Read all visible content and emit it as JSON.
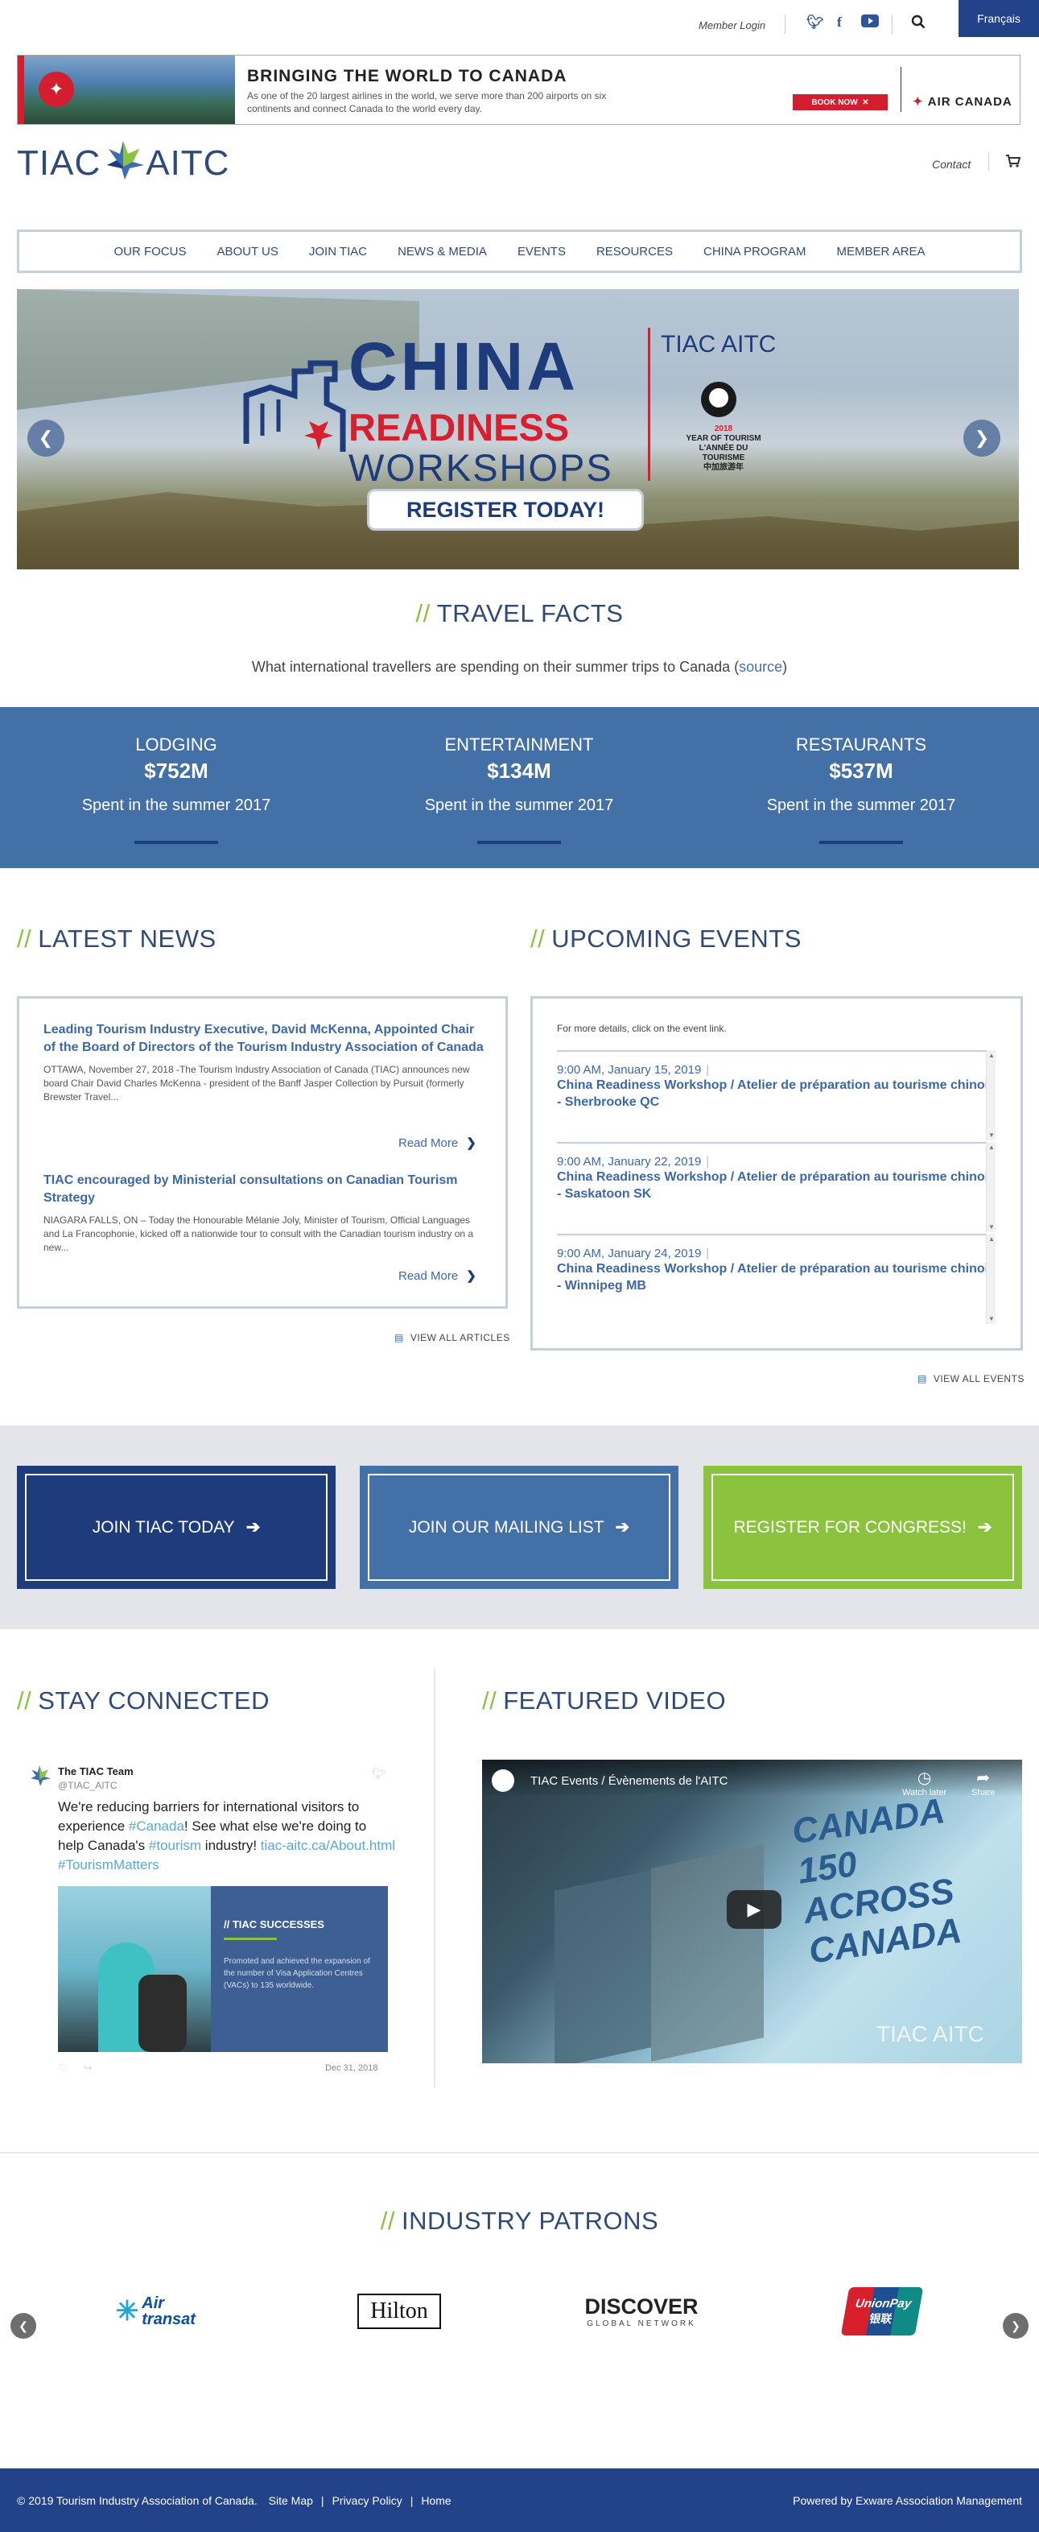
{
  "topbar": {
    "member_login": "Member Login",
    "language": "Français"
  },
  "ad": {
    "headline": "BRINGING THE WORLD TO CANADA",
    "subtext": "As one of the 20 largest airlines in the world, we serve more than 200 airports on six continents and connect Canada to the world every day.",
    "cta": "BOOK NOW",
    "brand": "AIR CANADA"
  },
  "logo": {
    "left": "TIAC",
    "right": "AITC"
  },
  "header": {
    "contact": "Contact"
  },
  "nav": [
    "OUR FOCUS",
    "ABOUT US",
    "JOIN TIAC",
    "NEWS & MEDIA",
    "EVENTS",
    "RESOURCES",
    "CHINA PROGRAM",
    "MEMBER AREA"
  ],
  "hero": {
    "line1": "CHINA",
    "line2": "READINESS",
    "line3": "WORKSHOPS",
    "logo": "TIAC AITC",
    "year_line1": "2018",
    "year_line2": "YEAR OF TOURISM",
    "year_line3": "L'ANNÉE DU TOURISME",
    "year_line4": "中加旅游年",
    "register": "REGISTER TODAY!"
  },
  "travel_facts": {
    "title": "TRAVEL FACTS",
    "intro": "What international travellers are spending on their summer trips to Canada (",
    "source_link": "source",
    "intro_end": ")",
    "facts": [
      {
        "label": "LODGING",
        "value": "$752M",
        "note": "Spent in the summer 2017"
      },
      {
        "label": "ENTERTAINMENT",
        "value": "$134M",
        "note": "Spent in the summer 2017"
      },
      {
        "label": "RESTAURANTS",
        "value": "$537M",
        "note": "Spent in the summer 2017"
      }
    ]
  },
  "news": {
    "title": "LATEST NEWS",
    "items": [
      {
        "title": "Leading Tourism Industry Executive, David McKenna, Appointed Chair of the Board of Directors of the Tourism Industry Association of Canada",
        "body": "OTTAWA, November 27, 2018 -The Tourism Industry Association of Canada (TIAC) announces new board Chair David Charles McKenna - president of the Banff Jasper Collection by Pursuit (formerly Brewster Travel..."
      },
      {
        "title": "TIAC encouraged by Ministerial consultations on Canadian Tourism Strategy",
        "body": "NIAGARA FALLS, ON – Today the Honourable Mélanie Joly, Minister of Tourism, Official Languages and La Francophonie, kicked off a nationwide tour to consult with the Canadian tourism industry on a new..."
      }
    ],
    "read_more": "Read More",
    "view_all": "VIEW ALL ARTICLES"
  },
  "events": {
    "title": "UPCOMING EVENTS",
    "note": "For more details, click on the event link.",
    "items": [
      {
        "time": "9:00 AM, January 15, 2019",
        "title": "China Readiness Workshop / Atelier de préparation au tourisme chinois - Sherbrooke QC"
      },
      {
        "time": "9:00 AM, January 22, 2019",
        "title": "China Readiness Workshop / Atelier de préparation au tourisme chinois - Saskatoon SK"
      },
      {
        "time": "9:00 AM, January 24, 2019",
        "title": "China Readiness Workshop / Atelier de préparation au tourisme chinois - Winnipeg MB"
      }
    ],
    "view_all": "VIEW ALL EVENTS"
  },
  "cta": [
    {
      "label": "JOIN TIAC TODAY",
      "color": "#1e3c7b"
    },
    {
      "label": "JOIN OUR MAILING LIST",
      "color": "#4470a8"
    },
    {
      "label": "REGISTER FOR CONGRESS!",
      "color": "#8bc33f"
    }
  ],
  "stay_connected": {
    "title": "STAY CONNECTED",
    "tweet": {
      "name": "The TIAC Team",
      "handle": "@TIAC_AITC",
      "text_1": "We're reducing barriers for international visitors to experience ",
      "tag_canada": "#Canada",
      "text_2": "! See what else we're doing to help Canada's ",
      "tag_tourism": "#tourism",
      "text_3": " industry! ",
      "link": "tiac-aitc.ca/About.html",
      "tag_matters": "#TourismMatters",
      "card_title": "// TIAC SUCCESSES",
      "card_body": "Promoted and achieved the expansion of the number of Visa Application Centres (VACs) to 135 worldwide.",
      "date": "Dec 31, 2018"
    }
  },
  "featured_video": {
    "title": "FEATURED VIDEO",
    "video_title": "TIAC Events / Évènements de l'AITC",
    "watch_later": "Watch later",
    "share": "Share",
    "overlay_text": "CANADA 150 ACROSS CANADA",
    "watermark": "TIAC AITC"
  },
  "patrons": {
    "title": "INDUSTRY PATRONS",
    "logos": [
      "Air transat",
      "Hilton",
      "DISCOVER",
      "GLOBAL NETWORK",
      "UnionPay",
      "银联"
    ]
  },
  "footer": {
    "copyright": "© 2019 Tourism Industry Association of Canada.",
    "links": [
      "Site Map",
      "Privacy Policy",
      "Home"
    ],
    "powered": "Powered by Exware Association Management"
  }
}
